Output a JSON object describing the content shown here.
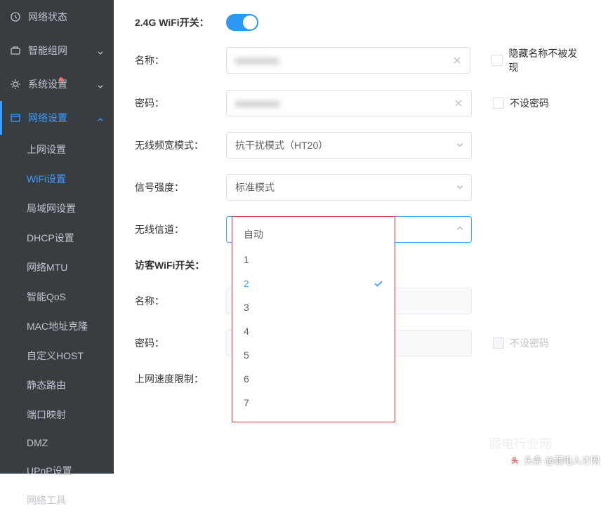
{
  "sidebar": {
    "nav": [
      {
        "label": "网络状态"
      },
      {
        "label": "智能组网"
      },
      {
        "label": "系统设置"
      },
      {
        "label": "网络设置"
      }
    ],
    "sub": [
      {
        "label": "上网设置"
      },
      {
        "label": "WiFi设置"
      },
      {
        "label": "局域网设置"
      },
      {
        "label": "DHCP设置"
      },
      {
        "label": "网络MTU"
      },
      {
        "label": "智能QoS"
      },
      {
        "label": "MAC地址克隆"
      },
      {
        "label": "自定义HOST"
      },
      {
        "label": "静态路由"
      },
      {
        "label": "端口映射"
      },
      {
        "label": "DMZ"
      },
      {
        "label": "UPnP设置"
      },
      {
        "label": "网络工具"
      }
    ]
  },
  "form": {
    "wifi_switch_label": "2.4G WiFi开关：",
    "name_label": "名称：",
    "name_value": "xxxxxxxxx",
    "hide_ssid_label": "隐藏名称不被发现",
    "password_label": "密码：",
    "password_value": "xxxxxxxxx",
    "no_password_label": "不设密码",
    "bandwidth_label": "无线频宽模式：",
    "bandwidth_value": "抗干扰模式（HT20）",
    "signal_label": "信号强度：",
    "signal_value": "标准模式",
    "channel_label": "无线信道：",
    "channel_value": "2",
    "guest_switch_label": "访客WiFi开关：",
    "guest_name_label": "名称：",
    "guest_password_label": "密码：",
    "guest_no_password_label": "不设密码",
    "guest_speed_label": "上网速度限制："
  },
  "channel_options": [
    "自动",
    "1",
    "2",
    "3",
    "4",
    "5",
    "6",
    "7"
  ],
  "watermark": {
    "text": "头条 @弱电人才网",
    "faint": "弱电行业网"
  }
}
